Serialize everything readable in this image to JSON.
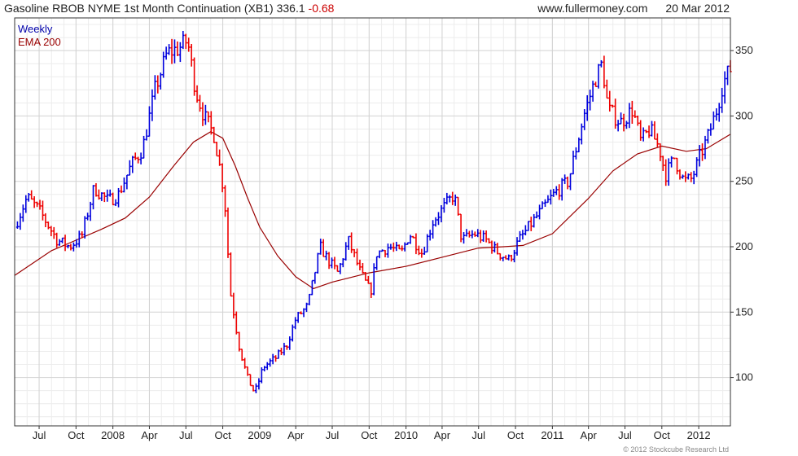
{
  "header": {
    "symbol_text": "Gasoline RBOB NYME 1st Month Continuation (XB1) 336.1",
    "change": "-0.68",
    "website": "www.fullermoney.com",
    "date": "20 Mar 2012"
  },
  "copyright": "© 2012 Stockcube Research Ltd",
  "colors": {
    "up": "#0000dd",
    "down": "#ee0000",
    "ema": "#990000",
    "legend_weekly": "#0000aa",
    "legend_ema": "#990000",
    "grid": "#d2d2d2"
  },
  "chart_data": {
    "type": "line",
    "chart_style": "weekly OHLC bars (up blue, down red) with EMA overlay",
    "x_axis": {
      "range": [
        "2007-05-01",
        "2012-03-20"
      ],
      "ticks": [
        {
          "label": "Jul",
          "date": "2007-07-01"
        },
        {
          "label": "Oct",
          "date": "2007-10-01"
        },
        {
          "label": "2008",
          "date": "2008-01-01"
        },
        {
          "label": "Apr",
          "date": "2008-04-01"
        },
        {
          "label": "Jul",
          "date": "2008-07-01"
        },
        {
          "label": "Oct",
          "date": "2008-10-01"
        },
        {
          "label": "2009",
          "date": "2009-01-01"
        },
        {
          "label": "Apr",
          "date": "2009-04-01"
        },
        {
          "label": "Jul",
          "date": "2009-07-01"
        },
        {
          "label": "Oct",
          "date": "2009-10-01"
        },
        {
          "label": "2010",
          "date": "2010-01-01"
        },
        {
          "label": "Apr",
          "date": "2010-04-01"
        },
        {
          "label": "Jul",
          "date": "2010-07-01"
        },
        {
          "label": "Oct",
          "date": "2010-10-01"
        },
        {
          "label": "2011",
          "date": "2011-01-01"
        },
        {
          "label": "Apr",
          "date": "2011-04-01"
        },
        {
          "label": "Jul",
          "date": "2011-07-01"
        },
        {
          "label": "Oct",
          "date": "2011-10-01"
        },
        {
          "label": "2012",
          "date": "2012-01-01"
        }
      ]
    },
    "y_axis": {
      "range": [
        63,
        375
      ],
      "ticks": [
        100,
        150,
        200,
        250,
        300,
        350
      ],
      "position": "right"
    },
    "grid": true,
    "legend": {
      "position": "top-left",
      "entries": [
        "Weekly",
        "EMA 200"
      ]
    },
    "series": [
      {
        "name": "Weekly",
        "approx_close": [
          {
            "x": "2007-05-01",
            "y": 215
          },
          {
            "x": "2007-06-01",
            "y": 238
          },
          {
            "x": "2007-07-01",
            "y": 228
          },
          {
            "x": "2007-08-15",
            "y": 205
          },
          {
            "x": "2007-09-15",
            "y": 200
          },
          {
            "x": "2007-10-15",
            "y": 208
          },
          {
            "x": "2007-11-15",
            "y": 245
          },
          {
            "x": "2007-12-20",
            "y": 235
          },
          {
            "x": "2008-01-15",
            "y": 240
          },
          {
            "x": "2008-02-15",
            "y": 262
          },
          {
            "x": "2008-03-15",
            "y": 275
          },
          {
            "x": "2008-04-15",
            "y": 320
          },
          {
            "x": "2008-05-15",
            "y": 348
          },
          {
            "x": "2008-06-15",
            "y": 352
          },
          {
            "x": "2008-07-05",
            "y": 358
          },
          {
            "x": "2008-07-25",
            "y": 320
          },
          {
            "x": "2008-08-15",
            "y": 300
          },
          {
            "x": "2008-09-10",
            "y": 285
          },
          {
            "x": "2008-10-05",
            "y": 240
          },
          {
            "x": "2008-10-20",
            "y": 165
          },
          {
            "x": "2008-11-10",
            "y": 125
          },
          {
            "x": "2008-12-01",
            "y": 100
          },
          {
            "x": "2008-12-20",
            "y": 88
          },
          {
            "x": "2009-01-10",
            "y": 108
          },
          {
            "x": "2009-02-10",
            "y": 115
          },
          {
            "x": "2009-03-10",
            "y": 125
          },
          {
            "x": "2009-04-01",
            "y": 145
          },
          {
            "x": "2009-05-01",
            "y": 155
          },
          {
            "x": "2009-06-01",
            "y": 200
          },
          {
            "x": "2009-06-20",
            "y": 190
          },
          {
            "x": "2009-07-15",
            "y": 180
          },
          {
            "x": "2009-08-10",
            "y": 205
          },
          {
            "x": "2009-09-10",
            "y": 180
          },
          {
            "x": "2009-10-05",
            "y": 165
          },
          {
            "x": "2009-10-20",
            "y": 195
          },
          {
            "x": "2009-11-20",
            "y": 200
          },
          {
            "x": "2009-12-20",
            "y": 195
          },
          {
            "x": "2010-01-10",
            "y": 210
          },
          {
            "x": "2010-02-10",
            "y": 195
          },
          {
            "x": "2010-03-10",
            "y": 220
          },
          {
            "x": "2010-04-10",
            "y": 232
          },
          {
            "x": "2010-05-01",
            "y": 240
          },
          {
            "x": "2010-05-20",
            "y": 205
          },
          {
            "x": "2010-06-20",
            "y": 210
          },
          {
            "x": "2010-07-20",
            "y": 205
          },
          {
            "x": "2010-08-20",
            "y": 195
          },
          {
            "x": "2010-09-15",
            "y": 190
          },
          {
            "x": "2010-10-10",
            "y": 205
          },
          {
            "x": "2010-11-10",
            "y": 218
          },
          {
            "x": "2010-12-10",
            "y": 230
          },
          {
            "x": "2011-01-10",
            "y": 242
          },
          {
            "x": "2011-02-10",
            "y": 250
          },
          {
            "x": "2011-03-01",
            "y": 275
          },
          {
            "x": "2011-03-20",
            "y": 300
          },
          {
            "x": "2011-04-20",
            "y": 330
          },
          {
            "x": "2011-05-05",
            "y": 340
          },
          {
            "x": "2011-05-20",
            "y": 305
          },
          {
            "x": "2011-06-20",
            "y": 295
          },
          {
            "x": "2011-07-20",
            "y": 305
          },
          {
            "x": "2011-08-10",
            "y": 280
          },
          {
            "x": "2011-09-01",
            "y": 290
          },
          {
            "x": "2011-09-25",
            "y": 275
          },
          {
            "x": "2011-10-10",
            "y": 255
          },
          {
            "x": "2011-11-01",
            "y": 268
          },
          {
            "x": "2011-11-25",
            "y": 250
          },
          {
            "x": "2011-12-15",
            "y": 252
          },
          {
            "x": "2012-01-05",
            "y": 270
          },
          {
            "x": "2012-01-25",
            "y": 285
          },
          {
            "x": "2012-02-15",
            "y": 305
          },
          {
            "x": "2012-03-01",
            "y": 325
          },
          {
            "x": "2012-03-20",
            "y": 336
          }
        ]
      },
      {
        "name": "EMA 200",
        "values": [
          {
            "x": "2007-05-01",
            "y": 178
          },
          {
            "x": "2007-08-01",
            "y": 197
          },
          {
            "x": "2007-10-01",
            "y": 205
          },
          {
            "x": "2007-12-01",
            "y": 213
          },
          {
            "x": "2008-02-01",
            "y": 222
          },
          {
            "x": "2008-04-01",
            "y": 238
          },
          {
            "x": "2008-06-01",
            "y": 262
          },
          {
            "x": "2008-07-20",
            "y": 280
          },
          {
            "x": "2008-09-01",
            "y": 288
          },
          {
            "x": "2008-10-01",
            "y": 283
          },
          {
            "x": "2008-11-01",
            "y": 262
          },
          {
            "x": "2008-12-01",
            "y": 238
          },
          {
            "x": "2009-01-01",
            "y": 215
          },
          {
            "x": "2009-02-15",
            "y": 193
          },
          {
            "x": "2009-04-01",
            "y": 177
          },
          {
            "x": "2009-05-15",
            "y": 168
          },
          {
            "x": "2009-07-01",
            "y": 173
          },
          {
            "x": "2009-10-01",
            "y": 180
          },
          {
            "x": "2010-01-01",
            "y": 185
          },
          {
            "x": "2010-04-01",
            "y": 192
          },
          {
            "x": "2010-07-01",
            "y": 199
          },
          {
            "x": "2010-09-01",
            "y": 200
          },
          {
            "x": "2010-10-20",
            "y": 201
          },
          {
            "x": "2011-01-01",
            "y": 210
          },
          {
            "x": "2011-04-01",
            "y": 237
          },
          {
            "x": "2011-06-01",
            "y": 258
          },
          {
            "x": "2011-08-01",
            "y": 271
          },
          {
            "x": "2011-10-01",
            "y": 277
          },
          {
            "x": "2011-12-01",
            "y": 273
          },
          {
            "x": "2012-01-20",
            "y": 275
          },
          {
            "x": "2012-03-20",
            "y": 286
          }
        ]
      }
    ]
  }
}
